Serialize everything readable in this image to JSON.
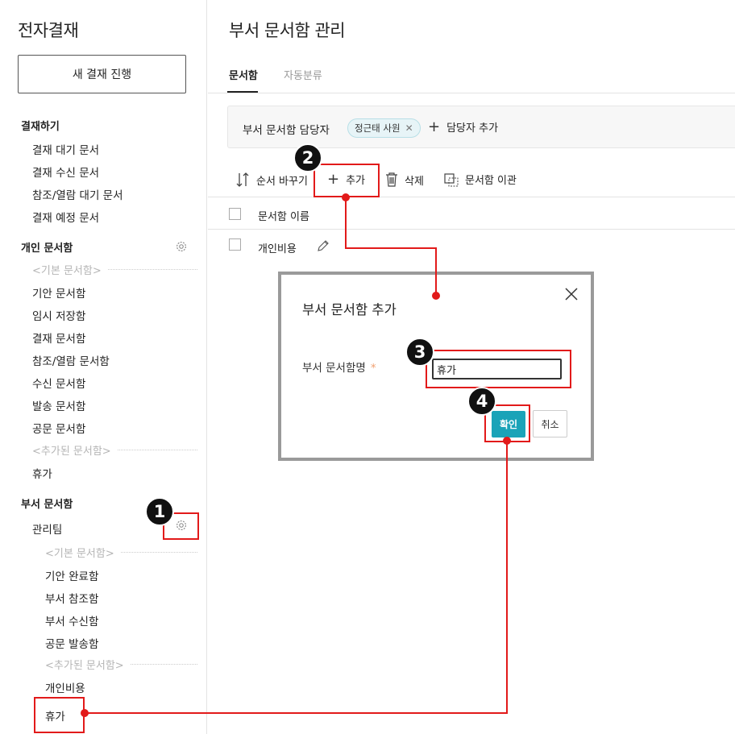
{
  "sidebar": {
    "app_title": "전자결재",
    "new_button": "새 결재 진행",
    "sections": {
      "approve": {
        "title": "결재하기",
        "items": [
          "결재 대기 문서",
          "결재 수신 문서",
          "참조/열람 대기 문서",
          "결재 예정 문서"
        ]
      },
      "personal": {
        "title": "개인 문서함",
        "basic_label": "<기본 문서함>",
        "items": [
          "기안 문서함",
          "임시 저장함",
          "결재 문서함",
          "참조/열람 문서함",
          "수신 문서함",
          "발송 문서함",
          "공문 문서함"
        ],
        "added_label": "<추가된 문서함>",
        "added_items": [
          "휴가"
        ]
      },
      "department": {
        "title": "부서 문서함",
        "team": "관리팀",
        "basic_label": "<기본 문서함>",
        "items": [
          "기안 완료함",
          "부서 참조함",
          "부서 수신함",
          "공문 발송함"
        ],
        "added_label": "<추가된 문서함>",
        "added_items": [
          "개인비용",
          "휴가"
        ]
      }
    }
  },
  "main": {
    "page_title": "부서 문서함 관리",
    "tabs": [
      {
        "label": "문서함",
        "active": true
      },
      {
        "label": "자동분류",
        "active": false
      }
    ],
    "manager": {
      "label": "부서 문서함 담당자",
      "chip": "정근태 사원",
      "add_label": "담당자 추가"
    },
    "toolbar": {
      "reorder": "순서 바꾸기",
      "add": "추가",
      "delete": "삭제",
      "transfer": "문서함 이관"
    },
    "list": {
      "header": "문서함 이름",
      "rows": [
        "개인비용"
      ]
    }
  },
  "dialog": {
    "title": "부서 문서함 추가",
    "field_label": "부서 문서함명",
    "required_mark": "*",
    "input_value": "휴가",
    "confirm": "확인",
    "cancel": "취소"
  },
  "annotations": {
    "badges": [
      "1",
      "2",
      "3",
      "4"
    ],
    "highlight_color": "#e21a1a"
  },
  "colors": {
    "accent": "#1aa3b8",
    "chip_bg": "#e7f4f7"
  }
}
